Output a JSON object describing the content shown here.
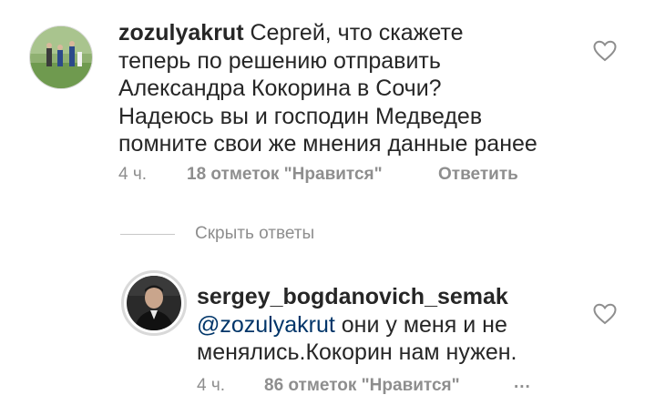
{
  "comments": [
    {
      "username": "zozulyakrut",
      "text": "Сергей, что скажете теперь по решению отправить Александра Кокорина в Сочи? Надеюсь вы и господин Медведев помните свои же мнения данные ранее",
      "time": "4 ч.",
      "likes": "18 отметок \"Нравится\"",
      "reply_label": "Ответить"
    }
  ],
  "thread": {
    "hide_replies_label": "Скрыть ответы"
  },
  "reply": {
    "username": "sergey_bogdanovich_semak",
    "mention": "@zozulyakrut",
    "text": " они у меня и не менялись.Кокорин нам нужен.",
    "time": "4 ч.",
    "likes": "86 отметок \"Нравится\"",
    "more_label": "..."
  },
  "colors": {
    "text": "#262626",
    "meta": "#8e8e8e",
    "mention": "#003569"
  },
  "icons": {
    "like": "heart-outline-icon"
  }
}
